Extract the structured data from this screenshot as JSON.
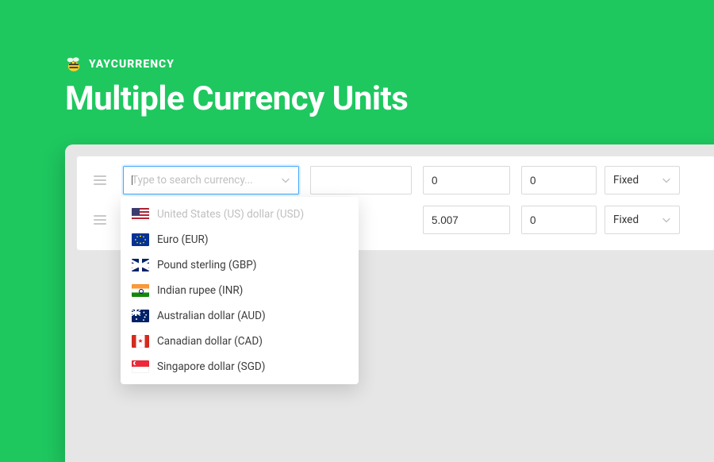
{
  "brand": {
    "name": "YAYCURRENCY"
  },
  "page_title": "Multiple Currency Units",
  "search": {
    "placeholder": "Type to search currency..."
  },
  "rows": [
    {
      "rate": "0",
      "adjust": "0",
      "mode": "Fixed"
    },
    {
      "rate": "5.007",
      "adjust": "0",
      "mode": "Fixed"
    }
  ],
  "options": [
    {
      "label": "United States (US) dollar (USD)",
      "flag": "us",
      "disabled": true
    },
    {
      "label": "Euro (EUR)",
      "flag": "eu",
      "disabled": false
    },
    {
      "label": "Pound sterling (GBP)",
      "flag": "gb",
      "disabled": false
    },
    {
      "label": "Indian rupee (INR)",
      "flag": "in",
      "disabled": false
    },
    {
      "label": "Australian dollar (AUD)",
      "flag": "au",
      "disabled": false
    },
    {
      "label": "Canadian dollar (CAD)",
      "flag": "ca",
      "disabled": false
    },
    {
      "label": "Singapore dollar (SGD)",
      "flag": "sg",
      "disabled": false
    }
  ]
}
